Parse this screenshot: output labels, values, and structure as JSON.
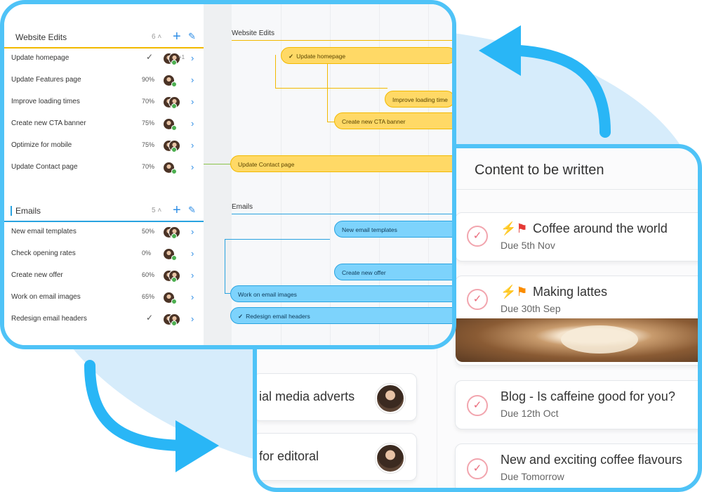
{
  "gantt": {
    "groups": [
      {
        "name": "Website Edits",
        "count": "6",
        "tasks": [
          {
            "name": "Update homepage",
            "progress": "",
            "done": true,
            "extra_assignees": "+1"
          },
          {
            "name": "Update Features page",
            "progress": "90%",
            "done": false
          },
          {
            "name": "Improve loading times",
            "progress": "70%",
            "done": false
          },
          {
            "name": "Create new CTA banner",
            "progress": "75%",
            "done": false
          },
          {
            "name": "Optimize for mobile",
            "progress": "75%",
            "done": false
          },
          {
            "name": "Update Contact page",
            "progress": "70%",
            "done": false
          }
        ]
      },
      {
        "name": "Emails",
        "count": "5",
        "tasks": [
          {
            "name": "New email templates",
            "progress": "50%",
            "done": false
          },
          {
            "name": "Check opening rates",
            "progress": "0%",
            "done": false
          },
          {
            "name": "Create new offer",
            "progress": "60%",
            "done": false
          },
          {
            "name": "Work on email images",
            "progress": "65%",
            "done": false
          },
          {
            "name": "Redesign email headers",
            "progress": "",
            "done": true
          }
        ]
      }
    ],
    "timeline": {
      "group_labels": [
        "Website Edits",
        "Emails"
      ],
      "bars": {
        "update_homepage": "Update homepage",
        "improve_loading": "Improve loading time",
        "cta_banner": "Create new CTA banner",
        "contact_page": "Update Contact page",
        "email_templates": "New email templates",
        "new_offer": "Create new offer",
        "email_images": "Work on email images",
        "email_headers": "Redesign email headers"
      }
    },
    "icons": {
      "check": "✓",
      "chevron": "›",
      "plus": "+",
      "pencil": "✎",
      "sort": "˄"
    }
  },
  "kanban": {
    "column_title": "Content to be written",
    "cards": [
      {
        "title": "Coffee around the world",
        "due": "Due 5th Nov"
      },
      {
        "title": "Making lattes",
        "due": "Due 30th Sep"
      },
      {
        "title": "Blog - Is caffeine good for you?",
        "due": "Due 12th Oct"
      },
      {
        "title": "New and exciting coffee flavours",
        "due": "Due Tomorrow"
      }
    ],
    "left_cards": [
      {
        "title": "ial media adverts"
      },
      {
        "title": "for editoral"
      }
    ]
  },
  "colors": {
    "accent": "#4fc3f7",
    "gantt_yellow": "#ffd966",
    "gantt_blue": "#7dd3fc",
    "link_blue": "#2f8ee6"
  }
}
